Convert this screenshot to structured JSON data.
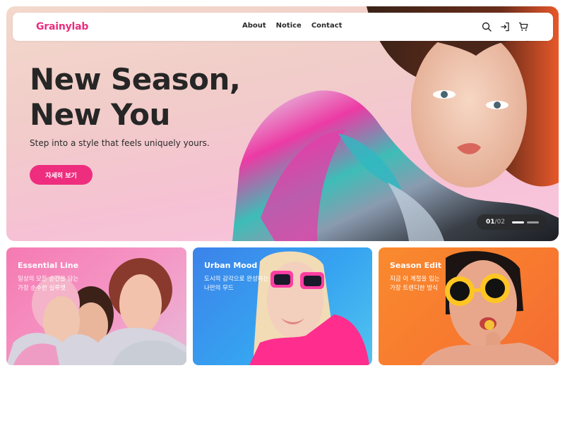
{
  "brand": {
    "logo": "Grainylab",
    "accent": "#ea2e7e"
  },
  "nav": {
    "links": [
      "About",
      "Notice",
      "Contact"
    ],
    "icons": [
      "search-icon",
      "login-icon",
      "cart-icon"
    ]
  },
  "hero": {
    "title_line1": "New Season,",
    "title_line2": "New You",
    "subtitle": "Step into a style that feels uniquely yours.",
    "cta": "자세히 보기",
    "pager": {
      "current": "01",
      "separator": "/",
      "total": "02"
    }
  },
  "cards": [
    {
      "title": "Essential Line",
      "desc_line1": "일상의 모든 순간을 담는",
      "desc_line2": "가장 순수한 실루엣",
      "color": "#f57ab2"
    },
    {
      "title": "Urban Mood",
      "desc_line1": "도시의 감각으로 완성하는",
      "desc_line2": "나만의 무드",
      "color": "#3c82ea"
    },
    {
      "title": "Season Edit",
      "desc_line1": "지금 이 계절을 입는",
      "desc_line2": "가장 트렌디한 방식",
      "color": "#f98a2e"
    }
  ]
}
